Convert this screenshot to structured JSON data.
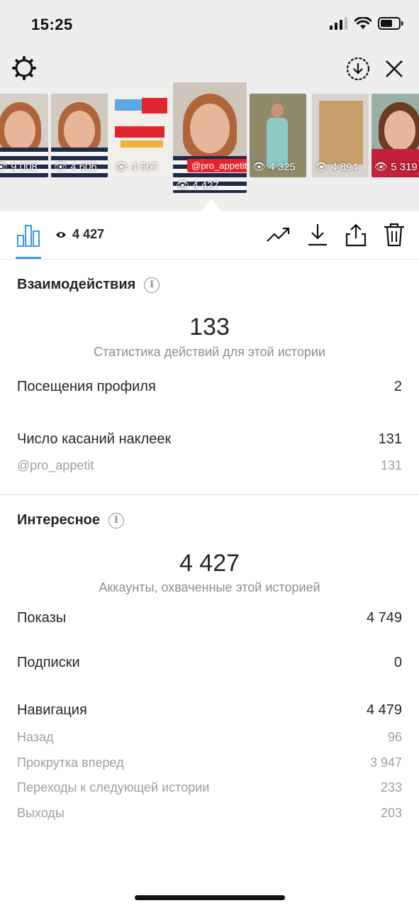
{
  "status_bar": {
    "time": "15:25"
  },
  "thumbnails": [
    {
      "count": "9 008"
    },
    {
      "count": "4 606"
    },
    {
      "count": "4 567"
    },
    {
      "count": "4 427",
      "tag": "@pro_appetit"
    },
    {
      "count": "4 325"
    },
    {
      "count": "4 894"
    },
    {
      "count": "5 319"
    }
  ],
  "toolbar": {
    "views": "4 427"
  },
  "interactions": {
    "title": "Взаимодействия",
    "total": "133",
    "caption": "Статистика действий для этой истории",
    "rows": [
      {
        "label": "Посещения профиля",
        "value": "2"
      },
      {
        "label": "Число касаний наклеек",
        "value": "131"
      }
    ],
    "sub_rows": [
      {
        "label": "@pro_appetit",
        "value": "131"
      }
    ]
  },
  "discovery": {
    "title": "Интересное",
    "total": "4 427",
    "caption": "Аккаунты, охваченные этой историей",
    "rows": [
      {
        "label": "Показы",
        "value": "4 749"
      },
      {
        "label": "Подписки",
        "value": "0"
      },
      {
        "label": "Навигация",
        "value": "4 479"
      }
    ],
    "sub_rows": [
      {
        "label": "Назад",
        "value": "96"
      },
      {
        "label": "Прокрутка вперед",
        "value": "3 947"
      },
      {
        "label": "Переходы к следующей истории",
        "value": "233"
      },
      {
        "label": "Выходы",
        "value": "203"
      }
    ]
  },
  "colors": {
    "accent": "#3897f0",
    "tag": "#e2262f",
    "muted": "#8e8e8e"
  },
  "icons": [
    "signal-icon",
    "wifi-icon",
    "battery-icon",
    "gear-icon",
    "download-circle-icon",
    "close-icon",
    "bar-chart-icon",
    "eye-icon",
    "trending-icon",
    "download-icon",
    "share-icon",
    "trash-icon",
    "info-icon"
  ]
}
